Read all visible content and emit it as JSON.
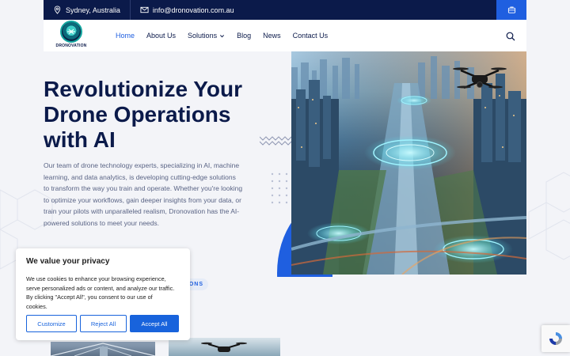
{
  "topbar": {
    "location": "Sydney, Australia",
    "email": "info@dronovation.com.au",
    "icons": {
      "location": "map-pin-icon",
      "email": "envelope-icon",
      "action": "briefcase-icon"
    }
  },
  "logo": {
    "name": "DRONOVATION"
  },
  "nav": {
    "items": [
      {
        "label": "Home",
        "active": true
      },
      {
        "label": "About Us"
      },
      {
        "label": "Solutions",
        "dropdown": true
      },
      {
        "label": "Blog"
      },
      {
        "label": "News"
      },
      {
        "label": "Contact Us"
      }
    ]
  },
  "hero": {
    "title_line1": "Revolutionize Your",
    "title_line2": "Drone Operations",
    "title_line3": "with AI",
    "desc_line1": "Our team of drone technology experts, specializing in AI, machine",
    "desc_line2": "learning, and data analytics, is developing cutting-edge solutions",
    "desc_line3": "to transform the way you train and operate. Whether you're looking",
    "desc_line4": "to optimize your workflows, gain deeper insights from your data, or",
    "desc_line5": "train your pilots with unparalleled realism, Dronovation has the AI-",
    "desc_line6": "powered solutions to meet your needs."
  },
  "section": {
    "tag": "IONS"
  },
  "cookie": {
    "title": "We value your privacy",
    "line1": "We use cookies to enhance your browsing experience,",
    "line2": "serve personalized ads or content, and analyze our traffic.",
    "line3": "By clicking \"Accept All\", you consent to our use of",
    "line4": "cookies.",
    "customize": "Customize",
    "reject": "Reject All",
    "accept": "Accept All"
  },
  "colors": {
    "navy": "#0b1a4a",
    "accent": "#1f5fe0",
    "cookie_blue": "#1863dc"
  }
}
